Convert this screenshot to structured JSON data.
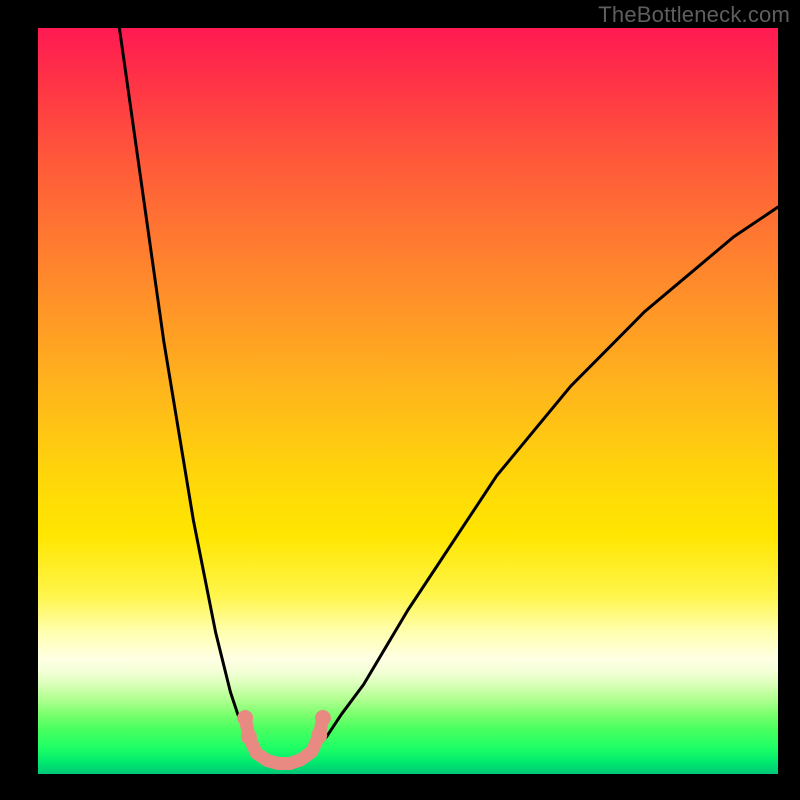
{
  "watermark": "TheBottleneck.com",
  "chart_data": {
    "type": "line",
    "title": "",
    "xlabel": "",
    "ylabel": "",
    "xlim": [
      0,
      100
    ],
    "ylim": [
      0,
      100
    ],
    "grid": false,
    "legend": false,
    "note": "Axes are unlabeled; values are percent positions read from the rendered image at the granularity shown.",
    "series": [
      {
        "name": "left-curve",
        "stroke": "#000000",
        "x": [
          11,
          12,
          13,
          14,
          15,
          16,
          17,
          18,
          19,
          20,
          21,
          22,
          23,
          24,
          25,
          26,
          27,
          28,
          29,
          30
        ],
        "y": [
          100,
          93,
          86,
          79,
          72,
          65,
          58,
          52,
          46,
          40,
          34,
          29,
          24,
          19,
          15,
          11,
          8,
          6,
          4,
          3
        ]
      },
      {
        "name": "right-curve",
        "stroke": "#000000",
        "x": [
          37,
          39,
          41,
          44,
          47,
          50,
          54,
          58,
          62,
          67,
          72,
          77,
          82,
          88,
          94,
          100
        ],
        "y": [
          3,
          5,
          8,
          12,
          17,
          22,
          28,
          34,
          40,
          46,
          52,
          57,
          62,
          67,
          72,
          76
        ]
      },
      {
        "name": "valley-band",
        "stroke": "#e98a82",
        "marker": "circle",
        "x": [
          28,
          28.5,
          29.5,
          31,
          32.5,
          34,
          35.5,
          37,
          38,
          38.5
        ],
        "y": [
          7.5,
          5.0,
          2.8,
          1.8,
          1.4,
          1.4,
          1.9,
          3.0,
          5.2,
          7.5
        ]
      }
    ],
    "gradient_stops": [
      {
        "pos": 0.0,
        "color": "#ff1a52"
      },
      {
        "pos": 0.07,
        "color": "#ff3246"
      },
      {
        "pos": 0.18,
        "color": "#ff5a3a"
      },
      {
        "pos": 0.32,
        "color": "#ff842d"
      },
      {
        "pos": 0.48,
        "color": "#ffb41c"
      },
      {
        "pos": 0.6,
        "color": "#ffd60a"
      },
      {
        "pos": 0.68,
        "color": "#ffe600"
      },
      {
        "pos": 0.76,
        "color": "#fff54a"
      },
      {
        "pos": 0.81,
        "color": "#ffffb0"
      },
      {
        "pos": 0.845,
        "color": "#ffffe4"
      },
      {
        "pos": 0.863,
        "color": "#f3ffd6"
      },
      {
        "pos": 0.88,
        "color": "#d9ffb8"
      },
      {
        "pos": 0.9,
        "color": "#b0ff90"
      },
      {
        "pos": 0.92,
        "color": "#7bff6e"
      },
      {
        "pos": 0.94,
        "color": "#49ff60"
      },
      {
        "pos": 0.965,
        "color": "#1eff66"
      },
      {
        "pos": 0.985,
        "color": "#00e86e"
      },
      {
        "pos": 1.0,
        "color": "#00c678"
      }
    ]
  }
}
